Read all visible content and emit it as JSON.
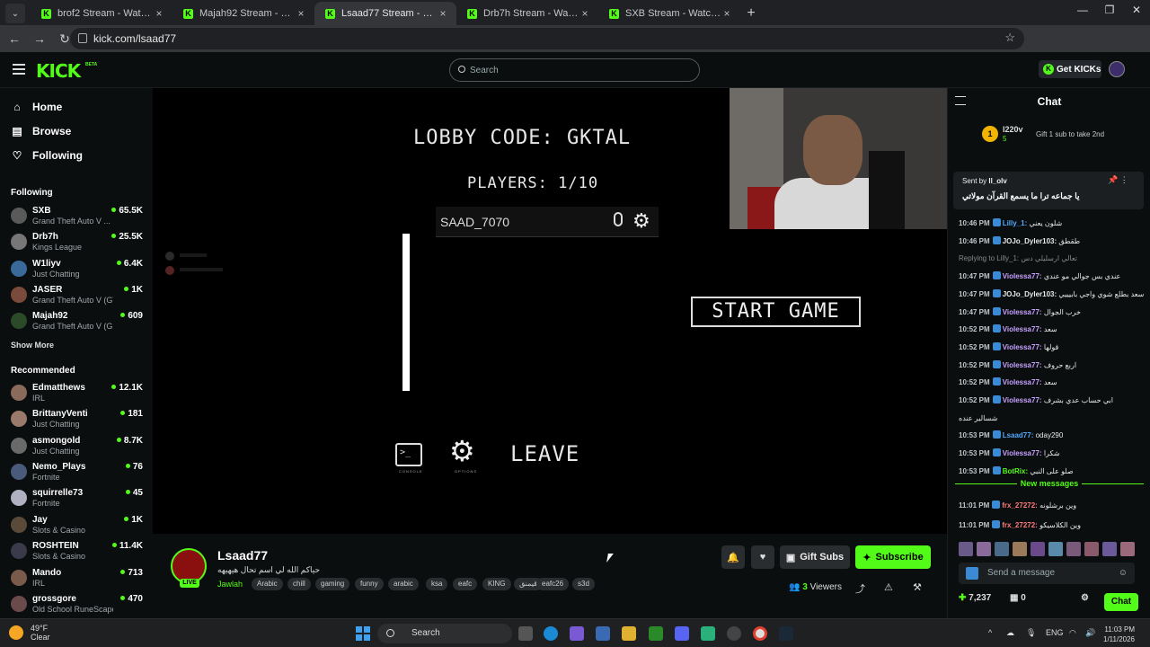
{
  "browser": {
    "tabs": [
      {
        "title": "brof2 Stream - Watch Live on K"
      },
      {
        "title": "Majah92 Stream - Watch Live o"
      },
      {
        "title": "Lsaad77 Stream - Watch Live o"
      },
      {
        "title": "Drb7h Stream - Watch Live on K"
      },
      {
        "title": "SXB Stream - Watch Live on Ki"
      }
    ],
    "url": "kick.com/lsaad77"
  },
  "header": {
    "logo": "KICK",
    "beta": "BETA",
    "search_placeholder": "Search",
    "get_kicks": "Get KICKs"
  },
  "sidebar": {
    "nav": [
      {
        "label": "Home",
        "icon": "home-icon"
      },
      {
        "label": "Browse",
        "icon": "browse-icon"
      },
      {
        "label": "Following",
        "icon": "heart-icon"
      }
    ],
    "following_title": "Following",
    "following": [
      {
        "name": "SXB",
        "game": "Grand Theft Auto V ...",
        "viewers": "65.5K"
      },
      {
        "name": "Drb7h",
        "game": "Kings League",
        "viewers": "25.5K"
      },
      {
        "name": "W1liyv",
        "game": "Just Chatting",
        "viewers": "6.4K"
      },
      {
        "name": "JASER",
        "game": "Grand Theft Auto V (GTA)",
        "viewers": "1K"
      },
      {
        "name": "Majah92",
        "game": "Grand Theft Auto V (G...",
        "viewers": "609"
      }
    ],
    "show_more": "Show More",
    "recommended_title": "Recommended",
    "recommended": [
      {
        "name": "Edmatthews",
        "game": "IRL",
        "viewers": "12.1K"
      },
      {
        "name": "BrittanyVenti",
        "game": "Just Chatting",
        "viewers": "181"
      },
      {
        "name": "asmongold",
        "game": "Just Chatting",
        "viewers": "8.7K"
      },
      {
        "name": "Nemo_Plays",
        "game": "Fortnite",
        "viewers": "76"
      },
      {
        "name": "squirrelle73",
        "game": "Fortnite",
        "viewers": "45"
      },
      {
        "name": "Jay",
        "game": "Slots & Casino",
        "viewers": "1K"
      },
      {
        "name": "ROSHTEIN",
        "game": "Slots & Casino",
        "viewers": "11.4K"
      },
      {
        "name": "Mando",
        "game": "IRL",
        "viewers": "713"
      },
      {
        "name": "grossgore",
        "game": "Old School RuneScape",
        "viewers": "470"
      }
    ]
  },
  "game": {
    "lobby_code": "LOBBY CODE: GKTAL",
    "players": "PLAYERS: 1/10",
    "player_name": "SAAD_7070",
    "start_game": "START GAME",
    "leave": "LEAVE",
    "console_glyph": ">_",
    "console_label": "CONSOLE",
    "options_label": "OPTIONS"
  },
  "stream": {
    "name": "Lsaad77",
    "title": "حياكم الله لي اسم تحال هيهيهه",
    "category": "Jawlah",
    "tags": [
      "Arabic",
      "chill",
      "gaming",
      "funny",
      "arabic",
      "ksa",
      "eafc",
      "KING",
      "قيمنق",
      "eafc26",
      "s3d"
    ],
    "live": "LIVE",
    "gift_subs": "Gift Subs",
    "subscribe": "Subscribe",
    "viewers_count": "3",
    "viewers_label": "Viewers"
  },
  "chat": {
    "title": "Chat",
    "top_gifter": {
      "name": "l220v",
      "count": "5",
      "rank": "1",
      "gift_text": "Gift 1 sub to take 2nd"
    },
    "pinned": {
      "sent_by": "Sent by",
      "user": "ll_olv",
      "text": "يا جماعه ترا ما يسمع القرآن مولاتي"
    },
    "messages": [
      {
        "time": "10:46 PM",
        "user": "Lilly_1:",
        "text": "شلون يعني",
        "color": "#53a8ff"
      },
      {
        "time": "10:46 PM",
        "user": "JOJo_Dyler103:",
        "text": "طقطق",
        "color": "#e8e8e8"
      },
      {
        "time": "",
        "user": "",
        "text": "Replying to Lilly_1: تعالي ارسليلي دس",
        "color": "#888888"
      },
      {
        "time": "10:47 PM",
        "user": "Violessa77:",
        "text": "عندي بس جوالي مو عندي",
        "color": "#c6a0ff"
      },
      {
        "time": "10:47 PM",
        "user": "JOJo_Dyler103:",
        "text": "سعد بطلع شوي واجي بابيييي",
        "color": "#e8e8e8"
      },
      {
        "time": "10:47 PM",
        "user": "Violessa77:",
        "text": "خرب الجوال",
        "color": "#c6a0ff"
      },
      {
        "time": "10:52 PM",
        "user": "Violessa77:",
        "text": "سعد",
        "color": "#c6a0ff"
      },
      {
        "time": "10:52 PM",
        "user": "Violessa77:",
        "text": "قولها",
        "color": "#c6a0ff"
      },
      {
        "time": "10:52 PM",
        "user": "Violessa77:",
        "text": "اربع حروف",
        "color": "#c6a0ff"
      },
      {
        "time": "10:52 PM",
        "user": "Violessa77:",
        "text": "سعد",
        "color": "#c6a0ff"
      },
      {
        "time": "10:52 PM",
        "user": "Violessa77:",
        "text": "ابي حساب عدي بشرف",
        "color": "#c6a0ff"
      },
      {
        "time": "",
        "user": "",
        "text": "شسالير عنده",
        "color": "#e8e8e8"
      },
      {
        "time": "10:53 PM",
        "user": "Lsaad77:",
        "text": "oday290",
        "color": "#53a8ff"
      },
      {
        "time": "10:53 PM",
        "user": "Violessa77:",
        "text": "شكرا",
        "color": "#c6a0ff"
      },
      {
        "time": "10:53 PM",
        "user": "BotRix:",
        "text": "صلو على النبي",
        "color": "#53fc18"
      }
    ],
    "new_messages_label": "New messages",
    "new_messages": [
      {
        "time": "11:01 PM",
        "user": "frx_27272:",
        "text": "وين برشلونه",
        "color": "#ff7a7a"
      },
      {
        "time": "11:01 PM",
        "user": "frx_27272:",
        "text": "وين الكلاسيكو",
        "color": "#ff7a7a"
      }
    ],
    "send_placeholder": "Send a message",
    "kicks_count": "7,237",
    "points": "0",
    "chat_button": "Chat"
  },
  "taskbar": {
    "temp": "49°F",
    "condition": "Clear",
    "search": "Search",
    "lang": "ENG",
    "time": "11:03 PM",
    "date": "1/11/2026"
  }
}
